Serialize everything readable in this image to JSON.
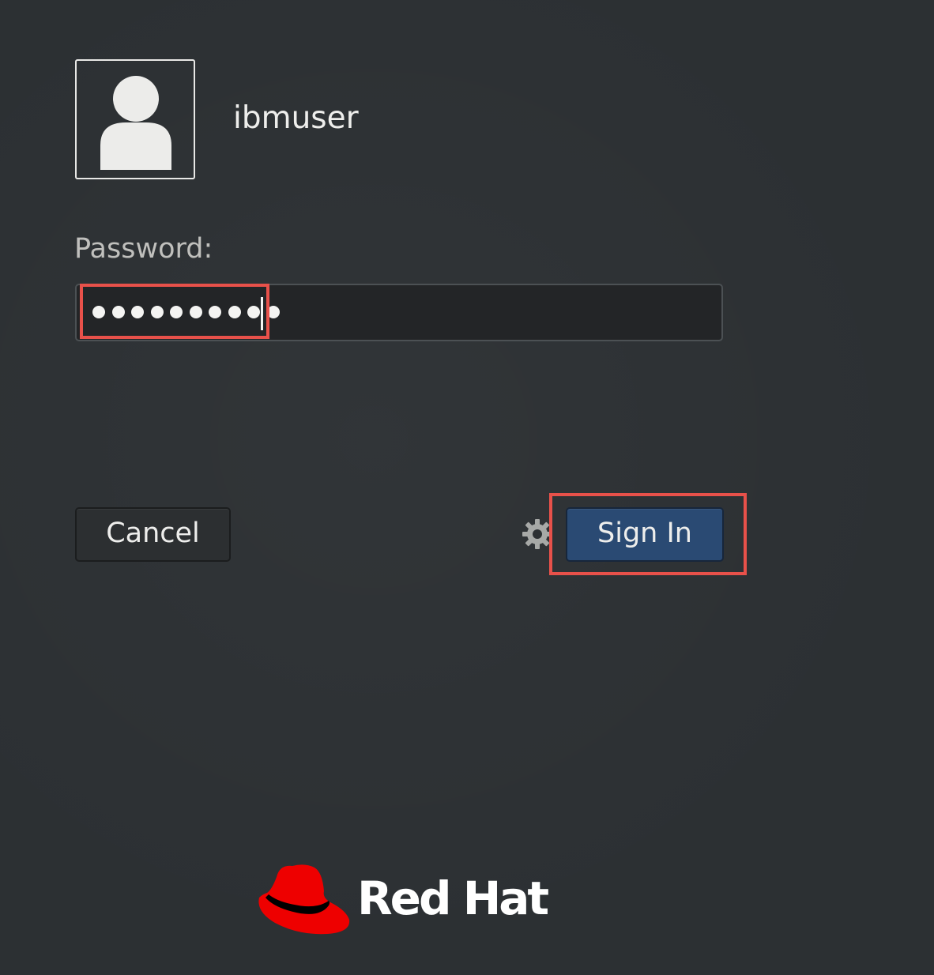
{
  "user": {
    "name": "ibmuser"
  },
  "password": {
    "label": "Password:",
    "masked_value": "••••••••••",
    "length": 10
  },
  "buttons": {
    "cancel": "Cancel",
    "sign_in": "Sign In"
  },
  "icons": {
    "avatar": "user-avatar-icon",
    "settings": "gear-icon",
    "logo": "red-hat-logo"
  },
  "logo": {
    "text": "Red Hat"
  },
  "colors": {
    "background": "#2c3033",
    "accent_button": "#2a4a73",
    "highlight": "#e8514a",
    "logo_red": "#ee0000"
  }
}
